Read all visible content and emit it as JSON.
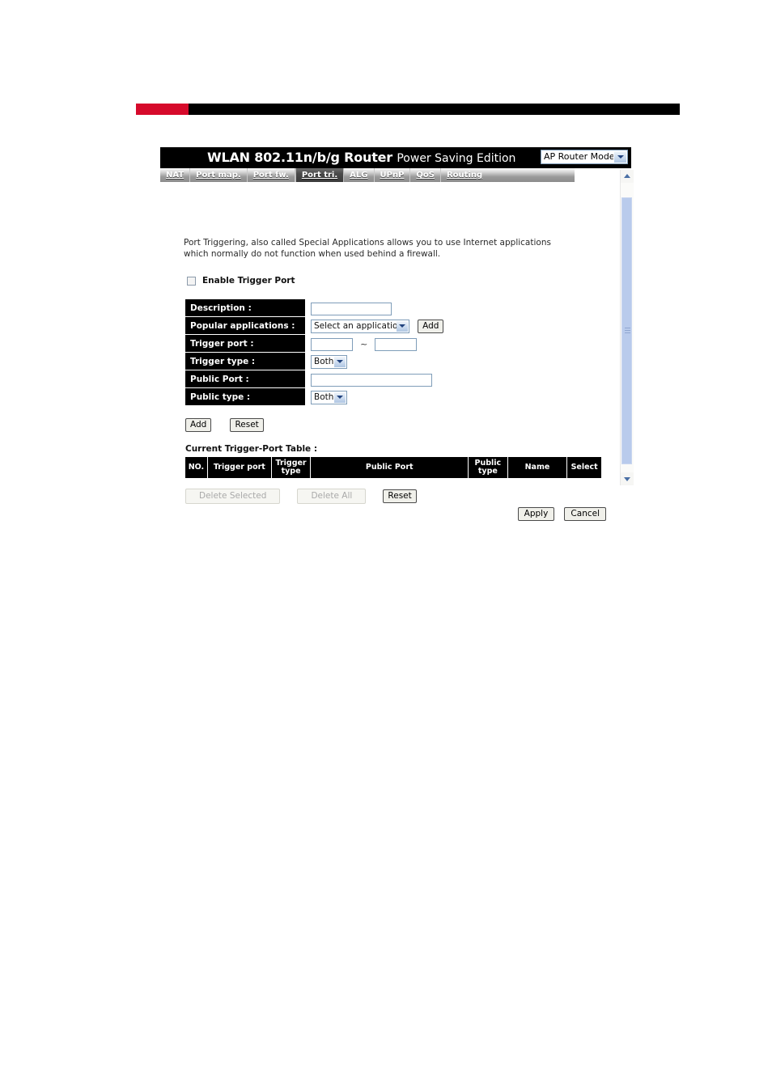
{
  "banner": {
    "accent_color": "#d60a2b",
    "bar_color": "#000000"
  },
  "header": {
    "title": "WLAN 802.11n/b/g Router",
    "subtitle": "Power Saving Edition",
    "mode_select": {
      "value": "AP Router Mode",
      "icon": "chevron-down-icon"
    }
  },
  "nav": {
    "tabs": [
      {
        "label": "NAT",
        "active": false
      },
      {
        "label": "Port map.",
        "active": false
      },
      {
        "label": "Port fw.",
        "active": false
      },
      {
        "label": "Port tri.",
        "active": true
      },
      {
        "label": "ALG",
        "active": false
      },
      {
        "label": "UPnP",
        "active": false
      },
      {
        "label": "QoS",
        "active": false
      },
      {
        "label": "Routing",
        "active": false
      }
    ]
  },
  "content": {
    "intro": "Port Triggering, also called Special Applications allows you to use Internet applications which normally do not function when used behind a firewall.",
    "enable_checkbox": {
      "label": "Enable Trigger Port",
      "checked": false
    },
    "form": {
      "rows": [
        {
          "label": "Description :"
        },
        {
          "label": "Popular applications :"
        },
        {
          "label": "Trigger port :"
        },
        {
          "label": "Trigger type :"
        },
        {
          "label": "Public Port :"
        },
        {
          "label": "Public type :"
        }
      ],
      "description_value": "",
      "description_placeholder": "",
      "popular_applications_value": "Select an application",
      "popular_applications_add_label": "Add",
      "trigger_port_from": "",
      "trigger_port_to": "",
      "trigger_port_separator": "~",
      "trigger_type_value": "Both",
      "public_port_value": "",
      "public_type_value": "Both"
    },
    "form_actions": {
      "add_label": "Add",
      "reset_label": "Reset"
    },
    "table": {
      "title": "Current Trigger-Port Table :",
      "columns": [
        "NO.",
        "Trigger port",
        "Trigger type",
        "Public Port",
        "Public type",
        "Name",
        "Select"
      ],
      "rows": []
    },
    "table_actions": {
      "delete_selected_label": "Delete Selected",
      "delete_selected_disabled": true,
      "delete_all_label": "Delete All",
      "delete_all_disabled": true,
      "reset_label": "Reset"
    },
    "page_actions": {
      "apply_label": "Apply",
      "cancel_label": "Cancel"
    }
  },
  "scrollbar": {
    "up_icon": "scroll-up-icon",
    "down_icon": "scroll-down-icon",
    "thumb_color": "#b9cbec"
  }
}
